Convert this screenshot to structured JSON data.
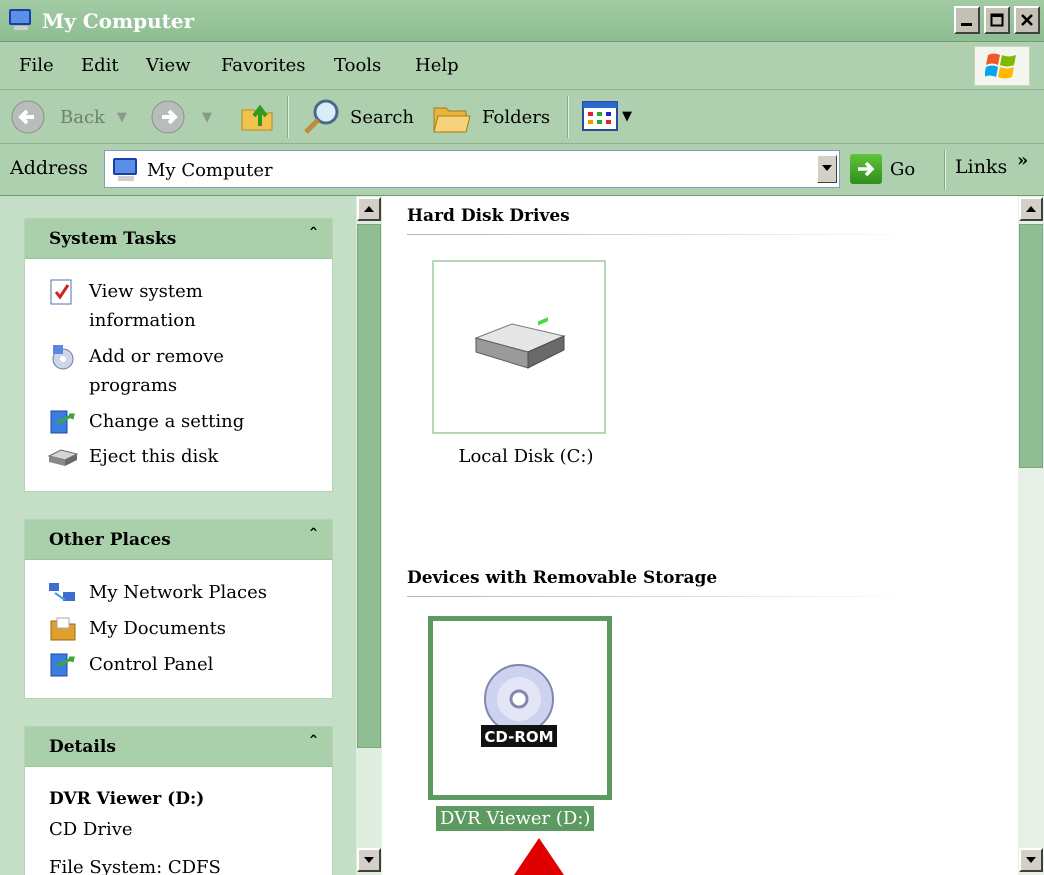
{
  "window": {
    "title": "My Computer"
  },
  "menu": [
    "File",
    "Edit",
    "View",
    "Favorites",
    "Tools",
    "Help"
  ],
  "toolbar": {
    "back_label": "Back",
    "search_label": "Search",
    "folders_label": "Folders"
  },
  "address": {
    "label": "Address",
    "value": "My Computer",
    "go_label": "Go",
    "links_label": "Links"
  },
  "tasks": {
    "system": {
      "title": "System Tasks",
      "items": [
        "View system information",
        "Add or remove programs",
        "Change a setting",
        "Eject this disk"
      ]
    },
    "other": {
      "title": "Other Places",
      "items": [
        "My Network Places",
        "My Documents",
        "Control Panel"
      ]
    },
    "details": {
      "title": "Details",
      "name": "DVR Viewer (D:)",
      "type": "CD Drive",
      "filesystem": "File System: CDFS"
    }
  },
  "content": {
    "hard_disks": {
      "title": "Hard Disk Drives",
      "items": [
        {
          "label": "Local Disk (C:)"
        }
      ]
    },
    "removable": {
      "title": "Devices with Removable Storage",
      "items": [
        {
          "label": "DVR Viewer (D:)",
          "badge": "CD-ROM",
          "selected": true
        }
      ]
    }
  },
  "colors": {
    "accent": "#5c9a62",
    "titlebar": "#8ebd91",
    "pane": "#c5dfc6",
    "pointer": "#e00000"
  },
  "icons": {
    "app": "my-computer-icon",
    "back": "back-arrow-icon",
    "forward": "forward-arrow-icon",
    "up": "up-folder-icon",
    "search": "magnifier-icon",
    "folders": "folders-icon",
    "views": "views-grid-icon"
  }
}
